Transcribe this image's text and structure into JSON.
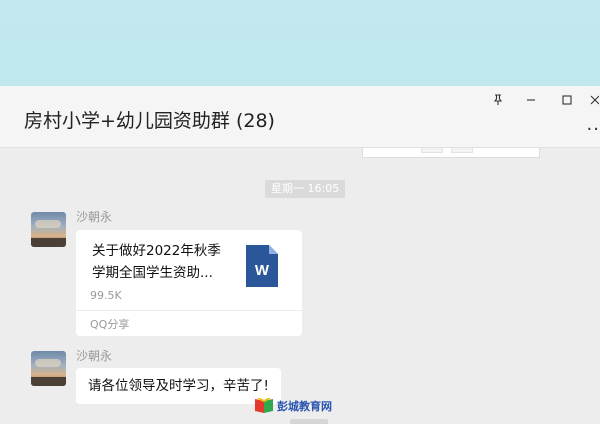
{
  "window": {
    "title": "房村小学+幼儿园资助群 (28)",
    "more_label": ".."
  },
  "messages": {
    "timestamp": "星期一 16:05",
    "items": [
      {
        "sender": "沙朝永",
        "type": "file",
        "file_name": "关于做好2022年秋季学期全国学生资助...",
        "file_size": "99.5K",
        "file_source": "QQ分享",
        "file_icon": "word-document-icon",
        "file_icon_letter": "W"
      },
      {
        "sender": "沙朝永",
        "type": "text",
        "text": "请各位领导及时学习，辛苦了!"
      }
    ]
  },
  "watermark": {
    "text": "彭城教育网",
    "icon": "book-logo-icon"
  },
  "colors": {
    "desktop_bg": "#c3e9ef",
    "chat_bg": "#ededed",
    "word_blue": "#2b579a",
    "watermark_blue": "#2a55b0"
  }
}
